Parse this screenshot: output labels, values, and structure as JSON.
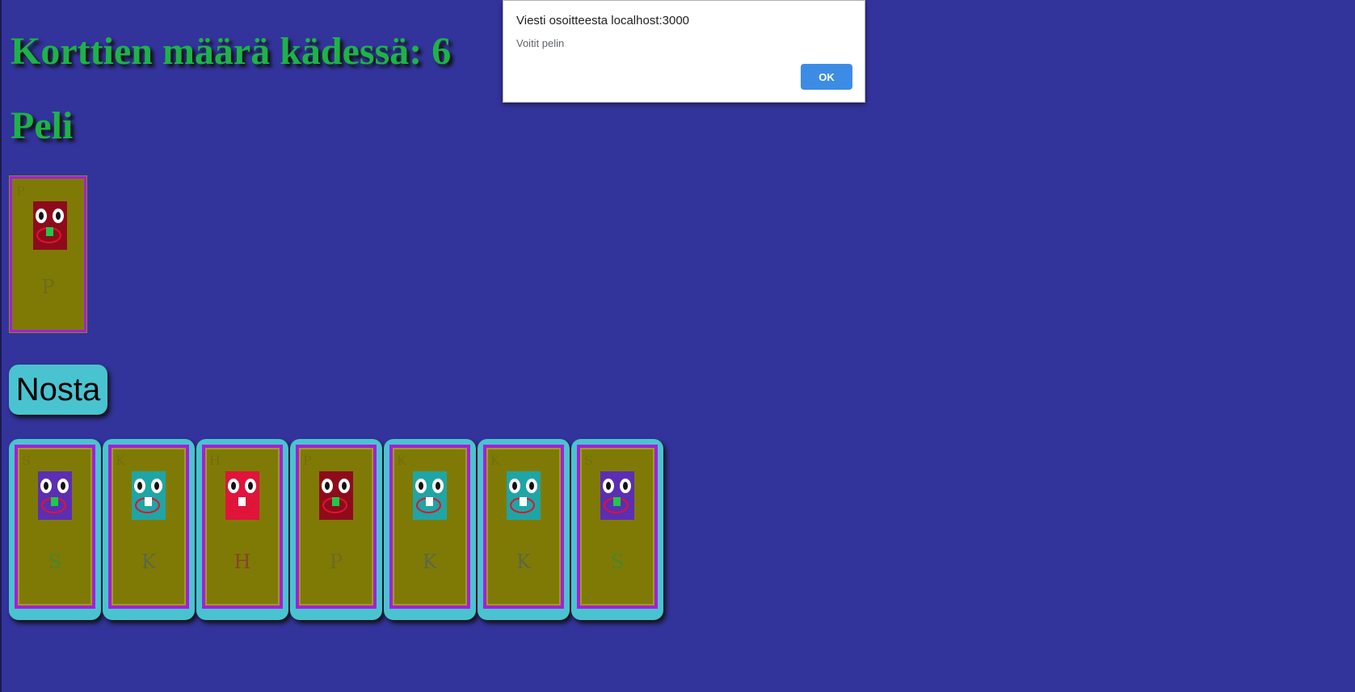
{
  "page": {
    "count_heading": "Korttien määrä kädessä: 6",
    "game_heading": "Peli"
  },
  "current_card": {
    "corner": "P",
    "letter": "P",
    "face_color": "#8e0b1c",
    "tooth_color": "#1ec94a"
  },
  "draw_button_label": "Nosta",
  "hand": [
    {
      "corner": "S",
      "letter": "S",
      "face_color": "#5b2eb3",
      "tooth_color": "#1ec94a"
    },
    {
      "corner": "K",
      "letter": "K",
      "face_color": "#1fa5a5",
      "tooth_color": "#ffffff"
    },
    {
      "corner": "H",
      "letter": "H",
      "face_color": "#e0143c",
      "tooth_color": "#ffffff"
    },
    {
      "corner": "P",
      "letter": "P",
      "face_color": "#8e0b1c",
      "tooth_color": "#1ec94a"
    },
    {
      "corner": "K",
      "letter": "K",
      "face_color": "#1fa5a5",
      "tooth_color": "#ffffff"
    },
    {
      "corner": "K",
      "letter": "K",
      "face_color": "#1fa5a5",
      "tooth_color": "#ffffff"
    },
    {
      "corner": "S",
      "letter": "S",
      "face_color": "#5b2eb3",
      "tooth_color": "#1ec94a"
    }
  ],
  "letter_colors": {
    "S": "#3f8a30",
    "K": "#556650",
    "H": "#8a3a30",
    "P": "#6b6a20"
  },
  "alert": {
    "title": "Viesti osoitteesta localhost:3000",
    "message": "Voitit pelin",
    "ok_label": "OK"
  },
  "colors": {
    "background": "#33339c",
    "heading": "#1db348",
    "card_fill": "#7f7a06",
    "card_border": "#a51fd7",
    "hand_card_frame": "#4ac3d0",
    "alert_button": "#3c8ce6"
  }
}
